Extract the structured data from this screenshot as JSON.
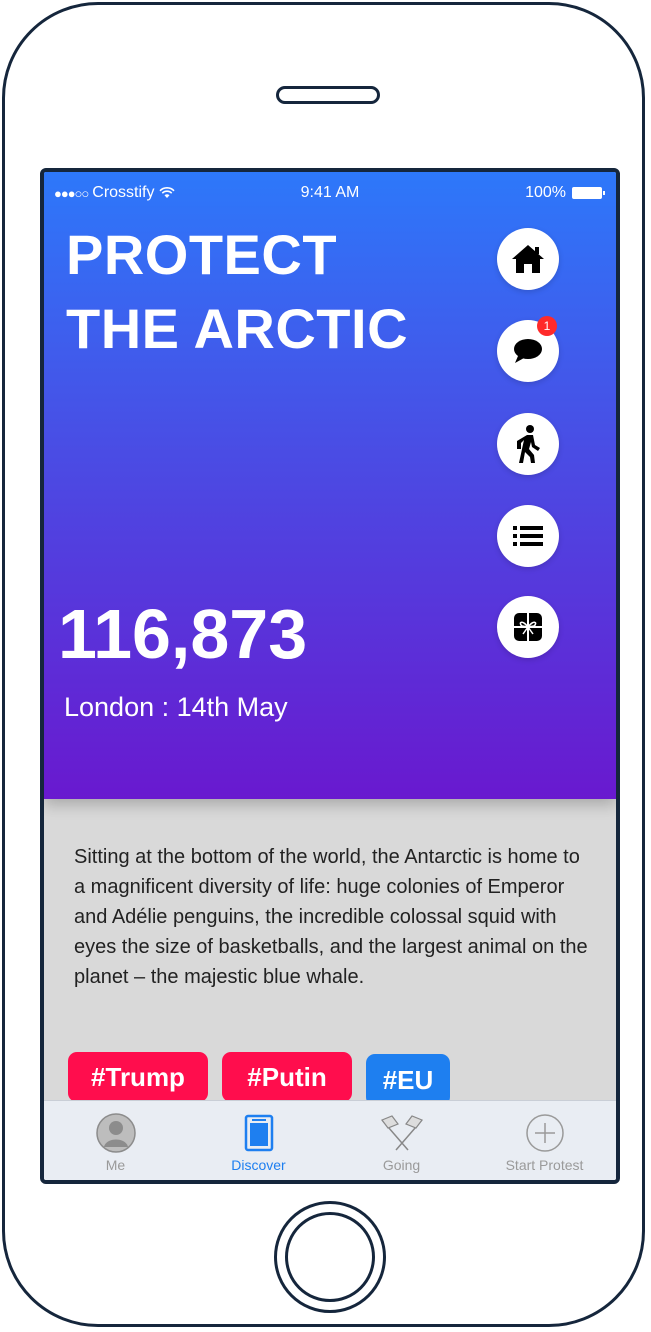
{
  "status_bar": {
    "carrier": "Crosstify",
    "time": "9:41 AM",
    "battery": "100%"
  },
  "hero": {
    "title_line1": "PROTECT",
    "title_line2": "THE ARCTIC",
    "count": "116,873",
    "location_date": "London : 14th May",
    "gradient_colors": [
      "#2d78fa",
      "#6919cf"
    ]
  },
  "actions": [
    {
      "icon": "home-icon"
    },
    {
      "icon": "chat-icon",
      "badge": "1"
    },
    {
      "icon": "walking-icon"
    },
    {
      "icon": "list-icon"
    },
    {
      "icon": "gift-icon"
    }
  ],
  "description": "Sitting at the bottom of the world, the Antarctic is home to a magnificent diversity of life: huge colonies of Emperor and Adélie penguins, the incredible colossal squid with eyes the size of basketballs, and the largest animal on the planet – the majestic blue whale.",
  "tags": [
    {
      "label": "#Trump",
      "color": "#ff0d4d"
    },
    {
      "label": "#Putin",
      "color": "#ff0d4d"
    },
    {
      "label": "#EU",
      "color": "#1e7ff0"
    }
  ],
  "tab_bar": {
    "active": "Discover",
    "tabs": [
      {
        "label": "Me",
        "icon": "avatar-icon"
      },
      {
        "label": "Discover",
        "icon": "book-icon"
      },
      {
        "label": "Going",
        "icon": "flags-icon"
      },
      {
        "label": "Start Protest",
        "icon": "plus-circle-icon"
      }
    ]
  }
}
